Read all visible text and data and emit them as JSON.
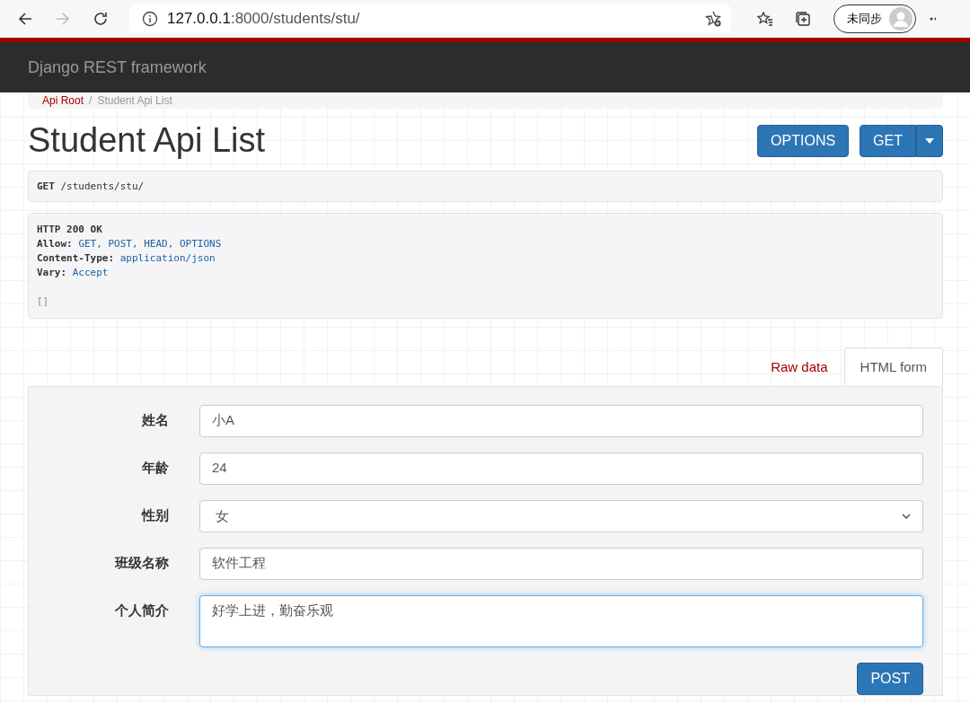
{
  "browser": {
    "back_disabled": false,
    "forward_disabled": true,
    "url_host": "127.0.0.1",
    "url_rest": ":8000/students/stu/",
    "profile_label": "未同步"
  },
  "navbar": {
    "brand": "Django REST framework"
  },
  "breadcrumb": {
    "separator": "/",
    "items": [
      {
        "label": "Api Root",
        "selected": false
      },
      {
        "label": "Student Api List",
        "selected": true
      }
    ]
  },
  "page": {
    "title": "Student Api List",
    "buttons": [
      {
        "label": "OPTIONS",
        "dropdown": false
      },
      {
        "label": "GET",
        "dropdown": true
      }
    ]
  },
  "request": {
    "method": "GET",
    "path": "/students/stu/"
  },
  "response": {
    "status": "HTTP 200 OK",
    "headers": [
      {
        "name": "Allow:",
        "value": "GET, POST, HEAD, OPTIONS"
      },
      {
        "name": "Content-Type:",
        "value": "application/json"
      },
      {
        "name": "Vary:",
        "value": "Accept"
      }
    ],
    "body": "[]"
  },
  "form_tabs": [
    {
      "label": "Raw data",
      "selected": false
    },
    {
      "label": "HTML form",
      "selected": true
    }
  ],
  "form": {
    "fields": [
      {
        "label": "姓名",
        "kind": "text",
        "value": "小A",
        "focused": false
      },
      {
        "label": "年龄",
        "kind": "text",
        "value": "24",
        "focused": false
      },
      {
        "label": "性别",
        "kind": "select",
        "value": "女",
        "focused": false
      },
      {
        "label": "班级名称",
        "kind": "text",
        "value": "软件工程",
        "focused": false
      },
      {
        "label": "个人简介",
        "kind": "textarea",
        "value": "好学上进，勤奋乐观",
        "focused": true
      }
    ],
    "submit": "POST"
  }
}
